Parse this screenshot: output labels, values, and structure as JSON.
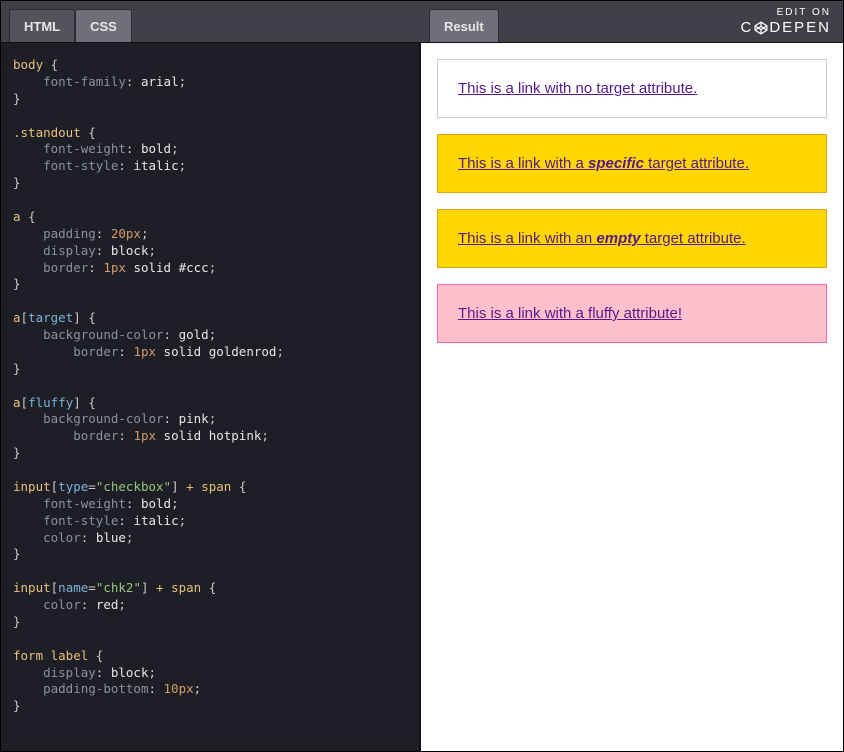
{
  "tabs": {
    "html": "HTML",
    "css": "CSS",
    "result": "Result"
  },
  "edit_on": {
    "label": "EDIT ON",
    "brand_left": "C",
    "brand_right": "DEPEN"
  },
  "code": {
    "l1_sel": "body",
    "l2_prop": "font-family",
    "l2_val": "arial",
    "l3_sel": ".standout",
    "l4_prop": "font-weight",
    "l4_val": "bold",
    "l5_prop": "font-style",
    "l5_val": "italic",
    "l6_sel": "a",
    "l7_prop": "padding",
    "l7_val": "20px",
    "l8_prop": "display",
    "l8_val": "block",
    "l9_prop": "border",
    "l9_val_num": "1px",
    "l9_val_rest": "solid #ccc",
    "l10_sel": "a",
    "l10_attr": "target",
    "l11_prop": "background-color",
    "l11_val": "gold",
    "l12_prop": "border",
    "l12_val_num": "1px",
    "l12_val_rest": "solid goldenrod",
    "l13_sel": "a",
    "l13_attr": "fluffy",
    "l14_prop": "background-color",
    "l14_val": "pink",
    "l15_prop": "border",
    "l15_val_num": "1px",
    "l15_val_rest": "solid hotpink",
    "l16_sel": "input",
    "l16_attr_key": "type",
    "l16_attr_val": "\"checkbox\"",
    "l16_comb": "+ span",
    "l17_prop": "font-weight",
    "l17_val": "bold",
    "l18_prop": "font-style",
    "l18_val": "italic",
    "l19_prop": "color",
    "l19_val": "blue",
    "l20_sel": "input",
    "l20_attr_key": "name",
    "l20_attr_val": "\"chk2\"",
    "l20_comb": "+ span",
    "l21_prop": "color",
    "l21_val": "red",
    "l22_sel": "form label",
    "l23_prop": "display",
    "l23_val": "block",
    "l24_prop": "padding-bottom",
    "l24_val": "10px"
  },
  "result": {
    "link1_pre": "This is a link with no target attribute.",
    "link2_pre": "This is a link with a ",
    "link2_em": "specific",
    "link2_post": " target attribute.",
    "link3_pre": "This is a link with an ",
    "link3_em": "empty",
    "link3_post": " target attribute.",
    "link4_pre": "This is a link with a fluffy attribute!"
  }
}
